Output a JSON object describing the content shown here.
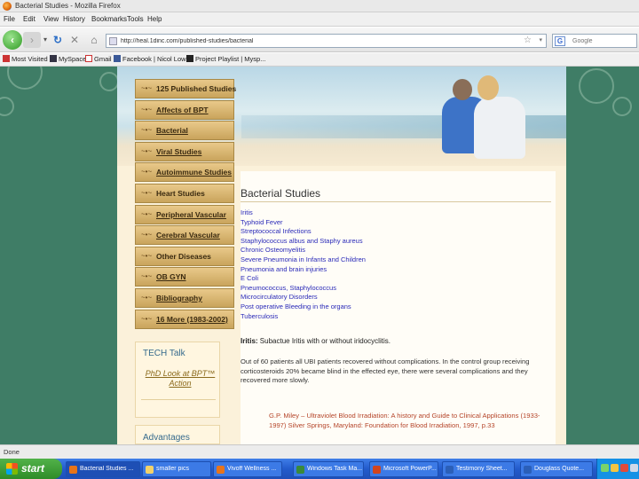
{
  "window": {
    "title": "Bacterial Studies - Mozilla Firefox"
  },
  "menu": [
    "File",
    "Edit",
    "View",
    "History",
    "Bookmarks",
    "Tools",
    "Help"
  ],
  "toolbar": {
    "url": "http://heal.1dinc.com/published-studies/bacterial",
    "search_placeholder": "Google"
  },
  "bookmarks": [
    "Most Visited",
    "MySpace",
    "Gmail",
    "Facebook | Nicol Lowe",
    "Project Playlist | Mysp..."
  ],
  "sidebar": {
    "items": [
      {
        "label": "125 Published Studies"
      },
      {
        "label": "Affects of BPT"
      },
      {
        "label": "Bacterial"
      },
      {
        "label": "Viral Studies"
      },
      {
        "label": "Autoimmune Studies"
      },
      {
        "label": "Heart Studies"
      },
      {
        "label": "Peripheral Vascular"
      },
      {
        "label": "Cerebral Vascular"
      },
      {
        "label": "Other Diseases"
      },
      {
        "label": "OB GYN"
      },
      {
        "label": "Bibliography"
      },
      {
        "label": "16 More (1983-2002)"
      }
    ]
  },
  "tech": {
    "heading": "TECH Talk",
    "link": "PhD Look at BPT™ Action"
  },
  "advantages": {
    "heading": "Advantages"
  },
  "content": {
    "title": "Bacterial Studies",
    "links": [
      "Iritis",
      "Typhoid Fever",
      "Streptococcal Infections",
      "Staphylococcus albus and Staphy aureus",
      "Chronic Osteomyelitis",
      "Severe Pneumonia in Infants and Children",
      "Pneumonia and brain injuries",
      "E Coli",
      "Pneumococcus, Staphylococcus",
      "Microcirculatory Disorders",
      "Post operative Bleeding in the organs",
      "Tuberculosis"
    ],
    "iritis_label": "Iritis:",
    "iritis_text": " Subactue Iritis with or without iridocyclitis.",
    "paragraph": "Out of 60 patients all UBI patients recovered without complications. In the control group receiving corticosteroids 20% became blind in the effected eye, there were several complications and they recovered more slowly.",
    "citation": "G.P. Miley – Ultraviolet Blood Irradiation: A history and Guide to Clinical Applications (1933-1997) Silver Springs, Maryland: Foundation for Blood Irradiation, 1997, p.33"
  },
  "status": {
    "text": "Done"
  },
  "taskbar": {
    "start_label": "start",
    "tasks": [
      "Bacterial Studies ...",
      "smaller pics",
      "Vivoff Wellness ...",
      "Windows Task Ma...",
      "Microsoft PowerP...",
      "Testimony Sheet...",
      "Douglass Quote..."
    ]
  }
}
